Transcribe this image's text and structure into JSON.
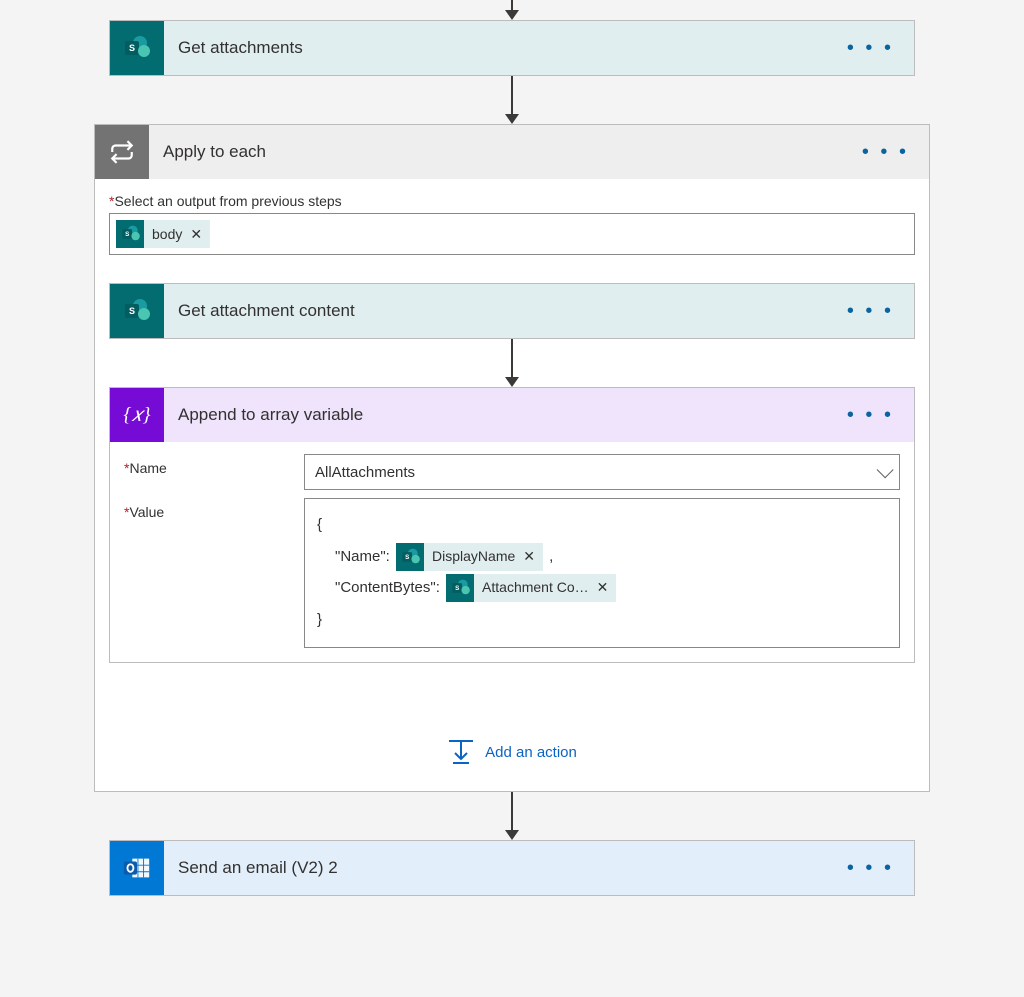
{
  "actions": {
    "getAttachments": {
      "title": "Get attachments"
    },
    "getAttachmentContent": {
      "title": "Get attachment content"
    },
    "appendArray": {
      "title": "Append to array variable",
      "fields": {
        "nameLabel": "Name",
        "nameValue": "AllAttachments",
        "valueLabel": "Value",
        "valueExpr": {
          "open": "{",
          "line1Key": "\"Name\":",
          "token1": "DisplayName",
          "comma": ",",
          "line2Key": "\"ContentBytes\":",
          "token2": "Attachment Co…",
          "close": "}"
        }
      }
    },
    "sendEmail": {
      "title": "Send an email (V2) 2"
    }
  },
  "scope": {
    "title": "Apply to each",
    "outputLabel": "Select an output from previous steps",
    "token": "body",
    "addAction": "Add an action"
  },
  "glyphLetter": "S"
}
